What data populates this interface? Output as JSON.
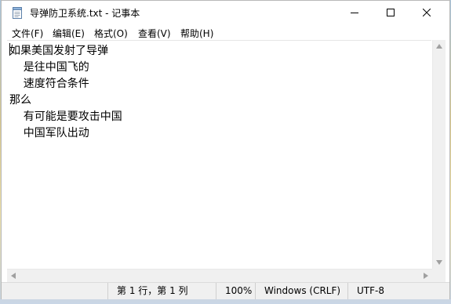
{
  "window": {
    "title": "导弹防卫系统.txt - 记事本",
    "icon": "notepad-icon"
  },
  "controls": {
    "minimize_icon": "minimize-icon",
    "maximize_icon": "maximize-icon",
    "close_icon": "close-icon"
  },
  "menu": {
    "file": "文件(F)",
    "edit": "编辑(E)",
    "format": "格式(O)",
    "view": "查看(V)",
    "help": "帮助(H)"
  },
  "document": {
    "lines": [
      "如果美国发射了导弹",
      "    是往中国飞的",
      "    速度符合条件",
      "那么",
      "    有可能是要攻击中国",
      "    中国军队出动"
    ]
  },
  "status": {
    "position": "第 1 行，第 1 列",
    "zoom": "100%",
    "line_ending": "Windows (CRLF)",
    "encoding": "UTF-8"
  }
}
